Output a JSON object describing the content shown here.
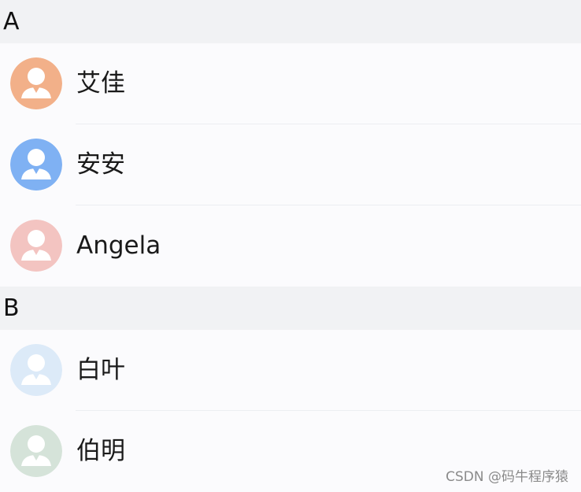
{
  "sections": [
    {
      "letter": "A",
      "contacts": [
        {
          "name": "艾佳",
          "avatar_color": "#f2b089"
        },
        {
          "name": "安安",
          "avatar_color": "#7fb1f3"
        },
        {
          "name": "Angela",
          "avatar_color": "#f3c4c1"
        }
      ]
    },
    {
      "letter": "B",
      "contacts": [
        {
          "name": "白叶",
          "avatar_color": "#dceaf8"
        },
        {
          "name": "伯明",
          "avatar_color": "#d5e3d9"
        }
      ]
    }
  ],
  "watermark": "CSDN @码牛程序猿"
}
